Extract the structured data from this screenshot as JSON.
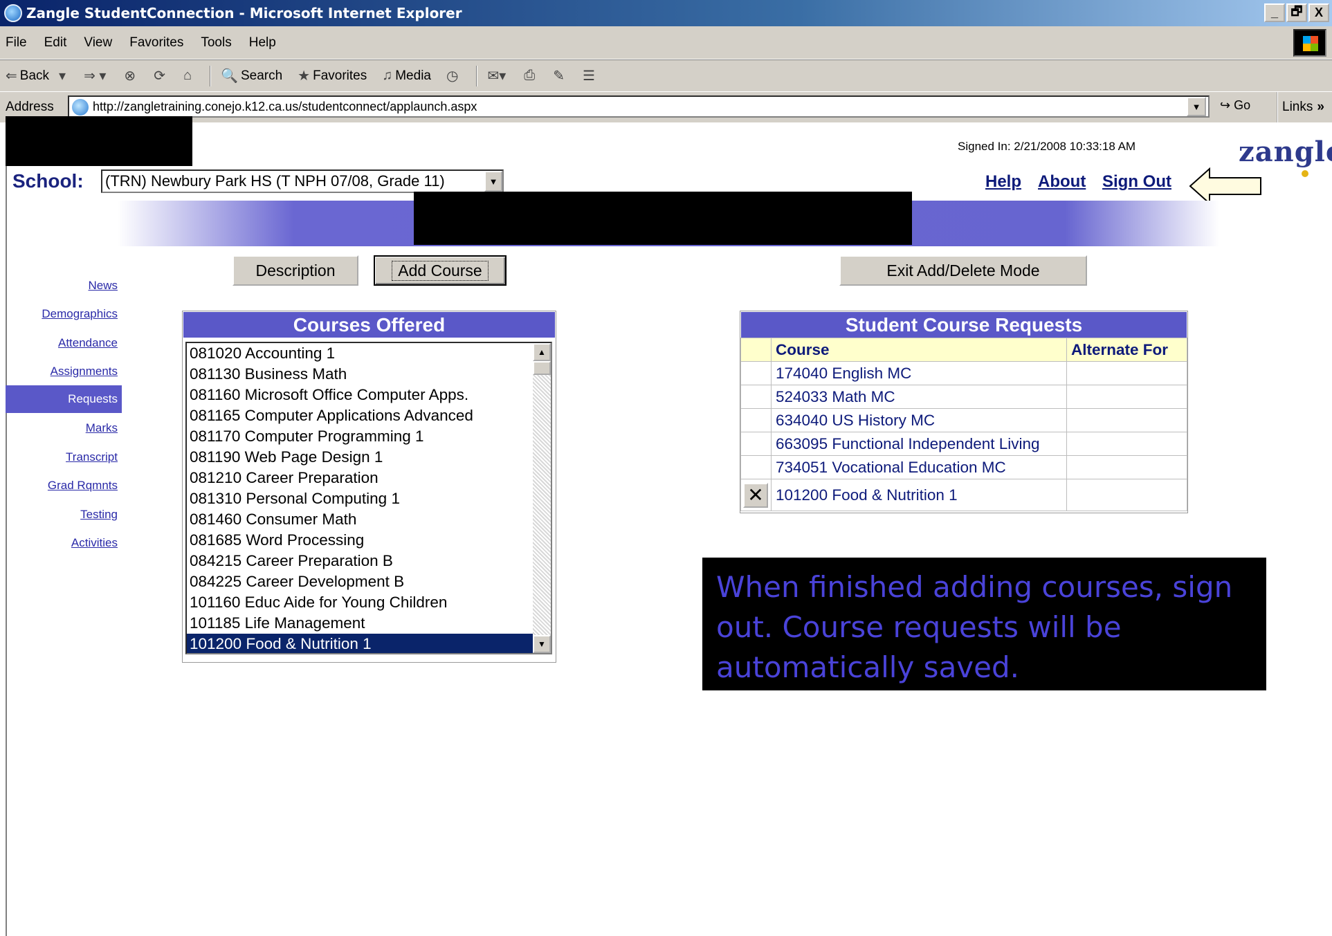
{
  "window": {
    "title": "Zangle StudentConnection - Microsoft Internet Explorer",
    "controls": [
      "_",
      "🗗",
      "X"
    ]
  },
  "menu": [
    "File",
    "Edit",
    "View",
    "Favorites",
    "Tools",
    "Help"
  ],
  "toolbar": {
    "back": "Back",
    "search": "Search",
    "favorites": "Favorites",
    "media": "Media"
  },
  "address": {
    "label": "Address",
    "url": "http://zangletraining.conejo.k12.ca.us/studentconnect/applaunch.aspx",
    "go": "Go",
    "links": "Links"
  },
  "header": {
    "signed_in": "Signed In: 2/21/2008 10:33:18 AM",
    "logo": "zangle",
    "school_label": "School:",
    "school_value": "(TRN) Newbury Park HS (T NPH 07/08, Grade 11)",
    "links": {
      "help": "Help",
      "about": "About",
      "sign_out": "Sign Out"
    }
  },
  "sidebar": {
    "items": [
      "News",
      "Demographics",
      "Attendance",
      "Assignments",
      "Requests",
      "Marks",
      "Transcript",
      "Grad Rqmnts",
      "Testing",
      "Activities"
    ],
    "active": "Requests"
  },
  "buttons": {
    "description": "Description",
    "add_course": "Add Course",
    "exit_mode": "Exit Add/Delete Mode"
  },
  "courses_offered": {
    "title": "Courses Offered",
    "items": [
      "081020 Accounting 1",
      "081130 Business Math",
      "081160 Microsoft Office Computer Apps.",
      "081165 Computer Applications Advanced",
      "081170 Computer Programming 1",
      "081190 Web Page Design 1",
      "081210 Career Preparation",
      "081310 Personal Computing 1",
      "081460 Consumer Math",
      "081685 Word Processing",
      "084215 Career Preparation B",
      "084225 Career Development B",
      "101160 Educ Aide for Young Children",
      "101185 Life Management",
      "101200 Food & Nutrition 1"
    ],
    "selected": "101200 Food & Nutrition 1"
  },
  "requests": {
    "title": "Student Course Requests",
    "columns": [
      "Course",
      "Alternate For"
    ],
    "rows": [
      {
        "course": "174040 English MC",
        "alternate": ""
      },
      {
        "course": "524033 Math MC",
        "alternate": ""
      },
      {
        "course": "634040 US History MC",
        "alternate": ""
      },
      {
        "course": "663095 Functional Independent Living",
        "alternate": ""
      },
      {
        "course": "734051 Vocational Education MC",
        "alternate": ""
      },
      {
        "course": "101200 Food & Nutrition 1",
        "alternate": "",
        "deletable": true
      }
    ],
    "delete_glyph": "✕"
  },
  "callout": {
    "text": "When finished adding courses, sign out.  Course requests will be automatically saved."
  },
  "colors": {
    "accent": "#5a58c8",
    "link": "#0d1a7a",
    "callout_text": "#4a43d9",
    "header_row": "#ffffcc"
  }
}
